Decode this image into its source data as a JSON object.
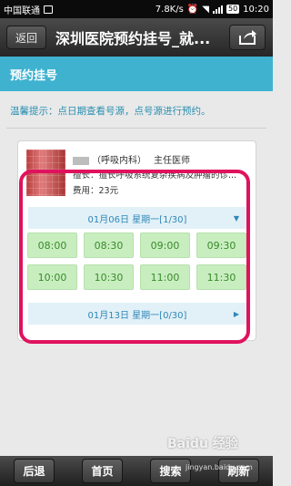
{
  "statusbar": {
    "carrier": "中国联通",
    "speed": "7.8K/s",
    "battery": "50",
    "time": "10:20"
  },
  "titlebar": {
    "back_label": "返回",
    "title": "深圳医院预约挂号_就..."
  },
  "section": {
    "title": "预约挂号"
  },
  "tip": "温馨提示：点日期查看号源，点号源进行预约。",
  "doctor": {
    "dept": "（呼吸内科）",
    "title": "主任医师",
    "specialty": "擅长：擅长呼吸系统复杂疾病及肿瘤的诊...",
    "fee": "费用：23元"
  },
  "schedule": {
    "date1": "01月06日 星期一[1/30]",
    "slots": [
      "08:00",
      "08:30",
      "09:00",
      "09:30",
      "10:00",
      "10:30",
      "11:00",
      "11:30"
    ],
    "date2": "01月13日 星期一[0/30]"
  },
  "toolbar": {
    "back": "后退",
    "home": "首页",
    "search": "搜索",
    "refresh": "刷新"
  },
  "watermark": {
    "brand": "Baidu 经验",
    "url": "jingyan.baidu.com"
  },
  "colors": {
    "accent": "#3fb2d0",
    "highlight": "#e0125d",
    "slot": "#c8eec0"
  }
}
